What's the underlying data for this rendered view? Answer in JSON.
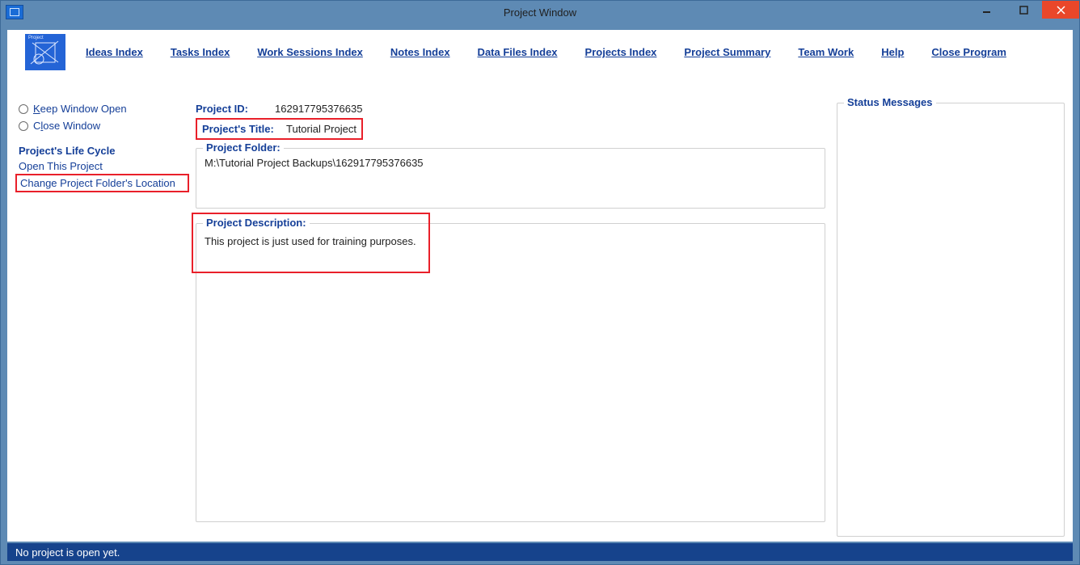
{
  "window": {
    "title": "Project Window"
  },
  "menu": {
    "ideas": "Ideas Index",
    "tasks": "Tasks Index",
    "work": "Work Sessions Index",
    "notes": "Notes Index",
    "data": "Data Files Index",
    "projects": "Projects Index",
    "summary": "Project Summary",
    "team": "Team Work",
    "help": "Help",
    "close": "Close Program"
  },
  "left": {
    "keep": "Keep Window Open",
    "close": "Close Window",
    "lifecycle": "Project's Life Cycle",
    "open": "Open This Project",
    "change": "Change Project Folder's Location"
  },
  "project": {
    "id_label": "Project ID:",
    "id_value": "162917795376635",
    "title_label": "Project's Title:",
    "title_value": "Tutorial Project",
    "folder_label": "Project Folder:",
    "folder_value": "M:\\Tutorial Project Backups\\162917795376635",
    "desc_label": "Project Description:",
    "desc_value": "This project is just used for training purposes."
  },
  "status": {
    "label": "Status Messages"
  },
  "footer": {
    "text": "No project is open yet."
  }
}
